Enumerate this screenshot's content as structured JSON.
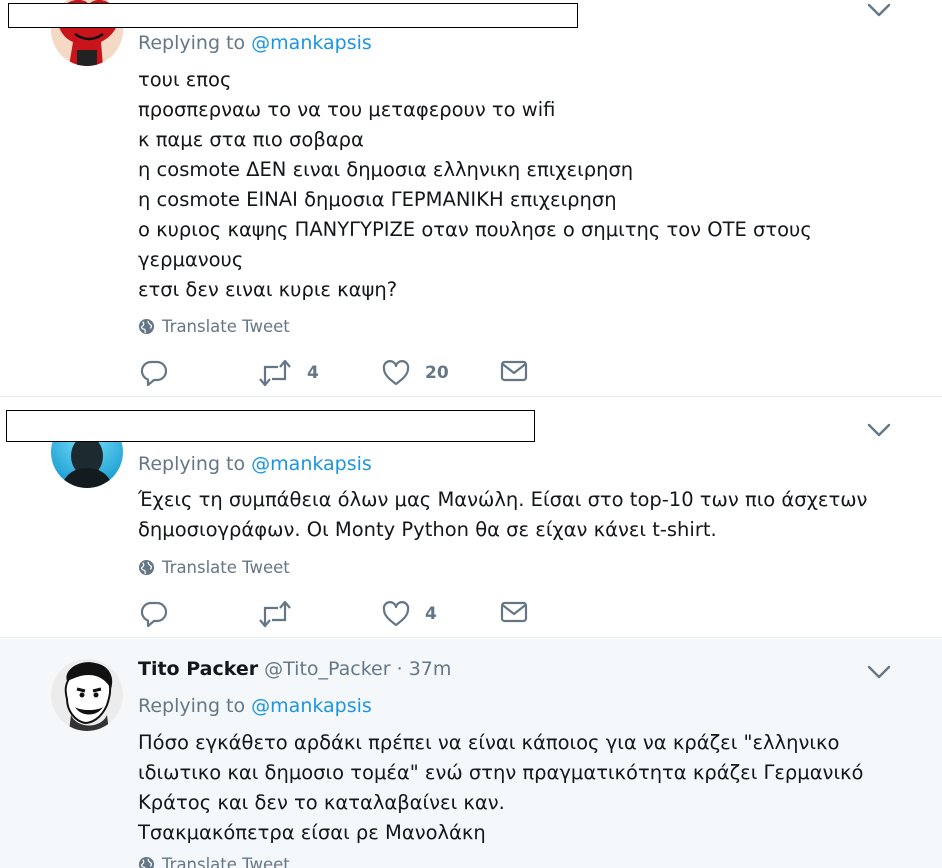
{
  "tweets": [
    {
      "replying_prefix": "Replying to",
      "mention": "@mankapsis",
      "lines": [
        "τουι επος",
        "προσπερναω το να του μεταφερουν το wifi",
        "κ παμε στα πιο σοβαρα",
        "η cosmote ΔΕΝ ειναι δημοσια ελληνικη επιχειρηση",
        "η cosmote ΕΙΝΑΙ δημοσια ΓΕΡΜΑΝΙΚΗ επιχειρηση",
        "ο κυριος καψης ΠΑΝΥΓΥΡΙΖΕ οταν πουλησε ο σημιτης τον ΟΤΕ στους",
        "γερμανους",
        "ετσι δεν ειναι κυριε καψη?"
      ],
      "translate": "Translate Tweet",
      "retweets": "4",
      "likes": "20"
    },
    {
      "replying_prefix": "Replying to",
      "mention": "@mankapsis",
      "lines": [
        "Έχεις τη συμπάθεια όλων μας Μανώλη. Είσαι στο top-10 των πιο άσχετων",
        "δημοσιογράφων. Οι Monty Python θα σε είχαν κάνει t-shirt."
      ],
      "translate": "Translate Tweet",
      "retweets": "",
      "likes": "4"
    },
    {
      "fullname": "Tito Packer",
      "handle": "@Tito_Packer",
      "separator": "·",
      "time": "37m",
      "replying_prefix": "Replying to",
      "mention": "@mankapsis",
      "lines": [
        "Πόσο εγκάθετο αρδάκι πρέπει να είναι κάποιος για να κράζει \"ελληνικο",
        "ιδιωτικο και δημοσιο τομέα\" ενώ στην πραγματικότητα κράζει Γερμανικό",
        "Κράτος και δεν το καταλαβαίνει καν.",
        "Τσακμακόπετρα είσαι ρε Μανολάκη"
      ],
      "translate": "Translate Tweet"
    }
  ],
  "icons": {
    "reply": "reply-icon",
    "retweet": "retweet-icon",
    "like": "heart-icon",
    "dm": "envelope-icon",
    "translate": "globe-icon",
    "caret": "chevron-down-icon"
  },
  "colors": {
    "link": "#1b95e0",
    "muted": "#657786",
    "text": "#14171a",
    "highlight_bg": "#f5f8fa",
    "divider": "#e6ecf0"
  }
}
